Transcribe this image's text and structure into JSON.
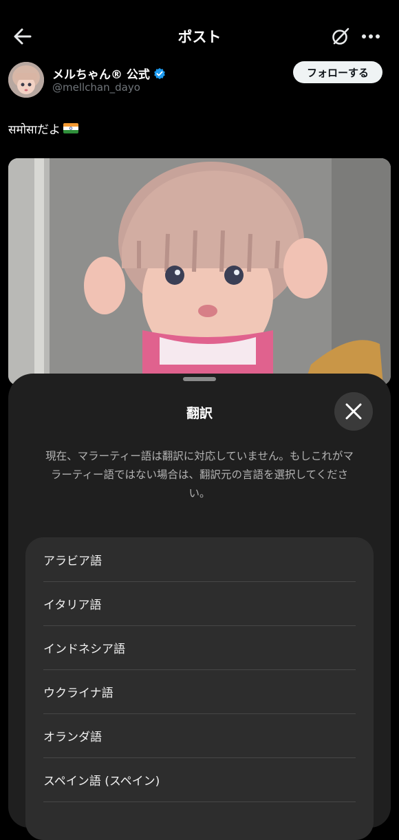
{
  "header": {
    "title": "ポスト"
  },
  "post": {
    "author_name": "メルちゃん® 公式",
    "handle": "@mellchan_dayo",
    "follow_label": "フォローする",
    "text": "समोसाだよ",
    "flag": "india-flag-emoji"
  },
  "translate_sheet": {
    "title": "翻訳",
    "notice": "現在、マラーティー語は翻訳に対応していません。もしこれがマラーティー語ではない場合は、翻訳元の言語を選択してください。",
    "languages": [
      "アラビア語",
      "イタリア語",
      "インドネシア語",
      "ウクライナ語",
      "オランダ語",
      "スペイン語 (スペイン)"
    ]
  },
  "colors": {
    "background": "#000000",
    "sheet": "#1f1f1f",
    "list": "#2d2d2d",
    "verified": "#1d9bf0"
  },
  "icons": [
    "back-arrow-icon",
    "grok-icon",
    "more-icon",
    "verified-badge-icon",
    "close-icon"
  ]
}
